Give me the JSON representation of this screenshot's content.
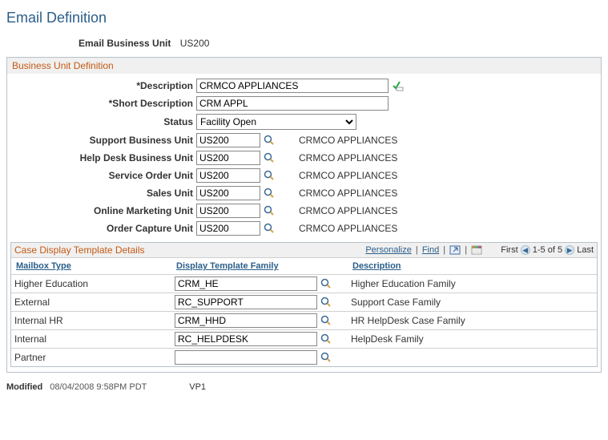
{
  "page_title": "Email Definition",
  "header": {
    "label": "Email Business Unit",
    "value": "US200"
  },
  "groupbox_title": "Business Unit Definition",
  "fields": {
    "description": {
      "label": "*Description",
      "value": "CRMCO APPLIANCES"
    },
    "short_description": {
      "label": "*Short Description",
      "value": "CRM APPL"
    },
    "status": {
      "label": "Status",
      "value": "Facility Open"
    },
    "support_bu": {
      "label": "Support Business Unit",
      "value": "US200",
      "desc": "CRMCO APPLIANCES"
    },
    "helpdesk_bu": {
      "label": "Help Desk Business Unit",
      "value": "US200",
      "desc": "CRMCO APPLIANCES"
    },
    "service_order_unit": {
      "label": "Service Order Unit",
      "value": "US200",
      "desc": "CRMCO APPLIANCES"
    },
    "sales_unit": {
      "label": "Sales Unit",
      "value": "US200",
      "desc": "CRMCO APPLIANCES"
    },
    "online_marketing_unit": {
      "label": "Online Marketing Unit",
      "value": "US200",
      "desc": "CRMCO APPLIANCES"
    },
    "order_capture_unit": {
      "label": "Order Capture Unit",
      "value": "US200",
      "desc": "CRMCO APPLIANCES"
    }
  },
  "grid": {
    "title": "Case Display Template Details",
    "personalize": "Personalize",
    "find": "Find",
    "nav": {
      "first": "First",
      "range": "1-5 of 5",
      "last": "Last"
    },
    "columns": {
      "c1": "Mailbox Type",
      "c2": "Display Template Family",
      "c3": "Description"
    },
    "rows": [
      {
        "mailbox": "Higher Education",
        "family": "CRM_HE",
        "desc": "Higher Education Family"
      },
      {
        "mailbox": "External",
        "family": "RC_SUPPORT",
        "desc": "Support Case Family"
      },
      {
        "mailbox": "Internal HR",
        "family": "CRM_HHD",
        "desc": "HR HelpDesk Case Family"
      },
      {
        "mailbox": "Internal",
        "family": "RC_HELPDESK",
        "desc": "HelpDesk Family"
      },
      {
        "mailbox": "Partner",
        "family": "",
        "desc": ""
      }
    ]
  },
  "footer": {
    "modified_label": "Modified",
    "modified_val": "08/04/2008  9:58PM PDT",
    "user": "VP1"
  }
}
